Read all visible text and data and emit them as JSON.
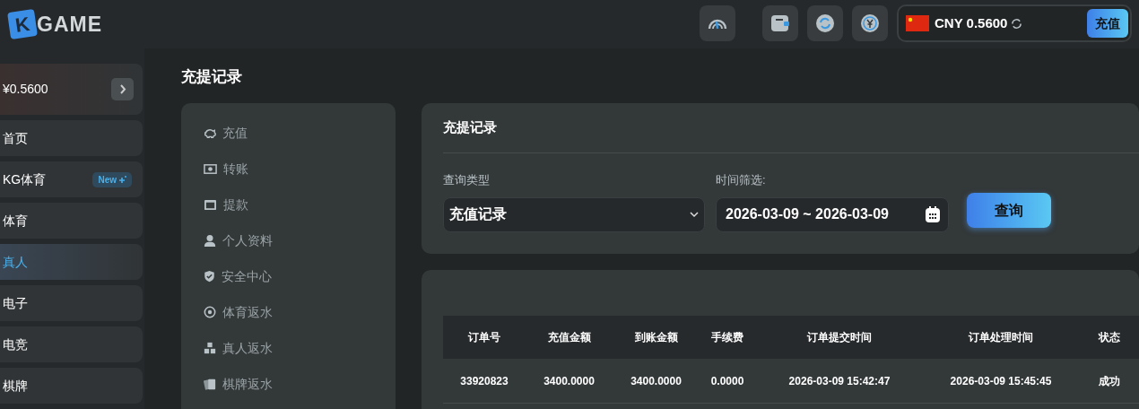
{
  "logo": {
    "mark": "K",
    "text": "GAME"
  },
  "header": {
    "balance": {
      "currency": "CNY 0.5600",
      "button": "充值"
    }
  },
  "sidebar": {
    "balance": "¥0.5600",
    "items": [
      {
        "label": "首页",
        "selected": false
      },
      {
        "label": "KG体育",
        "selected": false,
        "badge": "New"
      },
      {
        "label": "体育",
        "selected": false
      },
      {
        "label": "真人",
        "selected": true
      },
      {
        "label": "电子",
        "selected": false
      },
      {
        "label": "电竞",
        "selected": false
      },
      {
        "label": "棋牌",
        "selected": false
      }
    ]
  },
  "page_title": "充提记录",
  "submenu": [
    {
      "label": "充值",
      "kind": "piggy",
      "selected": false
    },
    {
      "label": "转账",
      "kind": "money",
      "selected": false
    },
    {
      "label": "提款",
      "kind": "atm",
      "selected": false
    },
    {
      "label": "个人资料",
      "kind": "user",
      "selected": false
    },
    {
      "label": "安全中心",
      "kind": "shield",
      "selected": false
    },
    {
      "label": "体育返水",
      "kind": "ball",
      "selected": false
    },
    {
      "label": "真人返水",
      "kind": "chips",
      "selected": false
    },
    {
      "label": "棋牌返水",
      "kind": "cards",
      "selected": false
    }
  ],
  "filter": {
    "title": "充提记录",
    "type_label": "查询类型",
    "type_value": "充值记录",
    "date_label": "时间筛选:",
    "date_value": "2026-03-09 ~ 2026-03-09",
    "button": "查询"
  },
  "table": {
    "columns": [
      "订单号",
      "充值金额",
      "到账金额",
      "手续费",
      "订单提交时间",
      "订单处理时间",
      "状态"
    ],
    "rows": [
      [
        "33920823",
        "3400.0000",
        "3400.0000",
        "0.0000",
        "2026-03-09 15:42:47",
        "2026-03-09 15:45:45",
        "成功"
      ]
    ]
  }
}
